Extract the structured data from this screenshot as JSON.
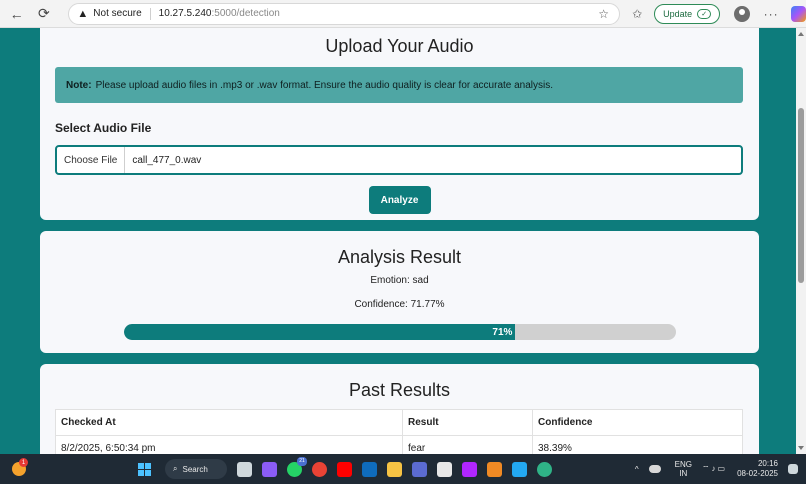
{
  "browser": {
    "security_label": "Not secure",
    "url_host": "10.27.5.240",
    "url_path": ":5000/detection",
    "update_label": "Update"
  },
  "upload": {
    "title": "Upload Your Audio",
    "note_label": "Note:",
    "note_text": "Please upload audio files in .mp3 or .wav format. Ensure the audio quality is clear for accurate analysis.",
    "select_label": "Select Audio File",
    "choose_label": "Choose File",
    "file_name": "call_477_0.wav",
    "analyze_label": "Analyze"
  },
  "result": {
    "title": "Analysis Result",
    "emotion": "Emotion: sad",
    "confidence": "Confidence: 71.77%",
    "progress_percent": 71,
    "progress_label": "71%"
  },
  "past": {
    "title": "Past Results",
    "headers": [
      "Checked At",
      "Result",
      "Confidence"
    ],
    "rows": [
      [
        "8/2/2025, 6:50:34 pm",
        "fear",
        "38.39%"
      ]
    ]
  },
  "taskbar": {
    "search_label": "Search",
    "weather_badge": "1",
    "lang_line1": "ENG",
    "lang_line2": "IN",
    "time": "20:16",
    "date": "08-02-2025",
    "icons": [
      {
        "name": "task-view-icon",
        "color": "#cfd8dc"
      },
      {
        "name": "copilot-app-icon",
        "color": "#8b5cf6"
      },
      {
        "name": "whatsapp-icon",
        "color": "#25d366"
      },
      {
        "name": "chrome-icon",
        "color": "#ea4335"
      },
      {
        "name": "youtube-icon",
        "color": "#ff0000"
      },
      {
        "name": "outlook-icon",
        "color": "#0f6cbd"
      },
      {
        "name": "file-explorer-icon",
        "color": "#f6c344"
      },
      {
        "name": "teams-icon",
        "color": "#5b6bd1"
      },
      {
        "name": "store-icon",
        "color": "#e8e8e8"
      },
      {
        "name": "jetbrains-icon",
        "color": "#b026ff"
      },
      {
        "name": "java-icon",
        "color": "#f08a24"
      },
      {
        "name": "vscode-icon",
        "color": "#23a9f2"
      },
      {
        "name": "edge-icon",
        "color": "#2fb387"
      }
    ]
  }
}
